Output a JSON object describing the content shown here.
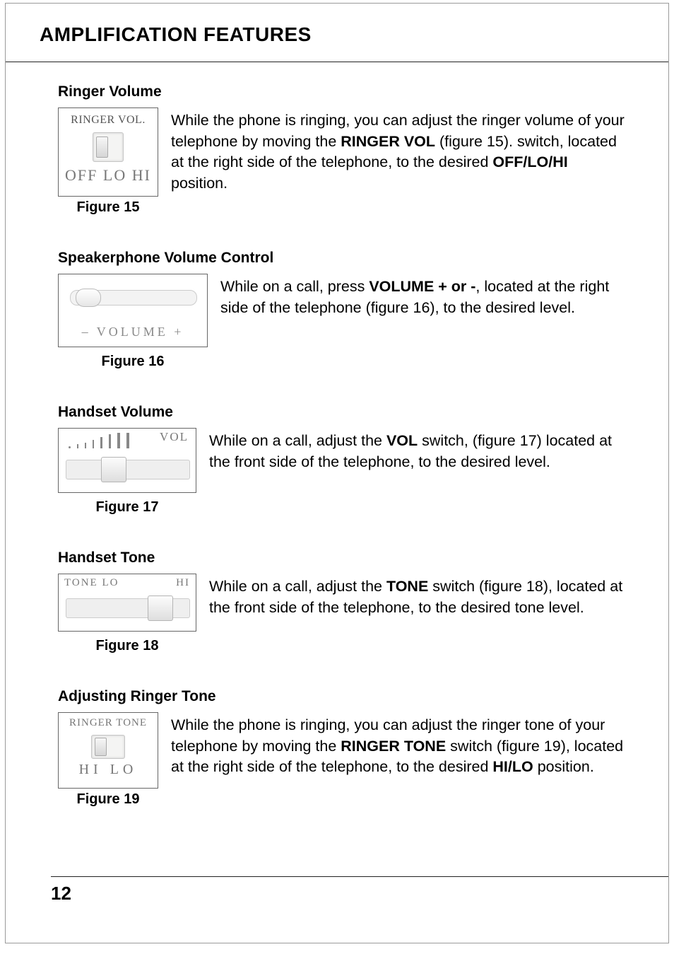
{
  "page_title": "AMPLIFICATION FEATURES",
  "page_number": "12",
  "sections": {
    "s1": {
      "heading": "Ringer Volume",
      "fig_top": "RINGER VOL.",
      "fig_bottom": "OFF LO HI",
      "caption": "Figure 15",
      "p_a": "While the phone is ringing, you can adjust the ringer volume of your telephone by moving the ",
      "p_b": "RINGER VOL",
      "p_c": " (figure 15). switch, located at the right side of the telephone, to the desired ",
      "p_d": "OFF/LO/HI",
      "p_e": " position."
    },
    "s2": {
      "heading": "Speakerphone Volume Control",
      "fig_label": "– VOLUME +",
      "caption": "Figure 16",
      "p_a": "While on a call, press ",
      "p_b": "VOLUME + or -",
      "p_c": ", located at the right side of the telephone (figure 16), to the desired level."
    },
    "s3": {
      "heading": "Handset Volume",
      "fig_label": "VOL",
      "caption": "Figure 17",
      "p_a": "While on a call, adjust the ",
      "p_b": "VOL",
      "p_c": " switch, (figure 17) located at the front side of the telephone, to the desired level."
    },
    "s4": {
      "heading": "Handset Tone",
      "fig_l": "TONE  LO",
      "fig_r": "HI",
      "caption": "Figure 18",
      "p_a": "While on a call, adjust the ",
      "p_b": "TONE",
      "p_c": " switch (figure 18), located at the front side of the telephone, to the desired tone level."
    },
    "s5": {
      "heading": "Adjusting Ringer Tone",
      "fig_top": "RINGER TONE",
      "fig_bottom": "HI   LO",
      "caption": "Figure 19",
      "p_a": "While the phone is ringing, you can adjust the ringer tone of your telephone by moving the ",
      "p_b": "RINGER TONE",
      "p_c": " switch (figure 19), located at the right side of the telephone, to the desired ",
      "p_d": "HI/LO",
      "p_e": " position."
    }
  }
}
